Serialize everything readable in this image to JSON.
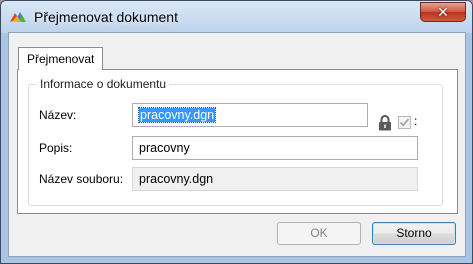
{
  "window": {
    "title": "Přejmenovat dokument",
    "app_icon": "rename-document-icon",
    "close_glyph": "✕",
    "close_icon": "close-icon"
  },
  "tabs": [
    {
      "label": "Přejmenovat",
      "active": true
    }
  ],
  "group": {
    "title": "Informace o dokumentu",
    "fields": {
      "name": {
        "label": "Název:",
        "value": "pracovny.dgn",
        "selected": true
      },
      "description": {
        "label": "Popis:",
        "value": "pracovny"
      },
      "filename": {
        "label": "Název souboru:",
        "value": "pracovny.dgn",
        "readonly": true
      }
    },
    "lock_icon": "lock-icon",
    "checkbox": {
      "checked": true,
      "disabled": true,
      "label": ":"
    }
  },
  "buttons": {
    "ok": {
      "label": "OK",
      "disabled": true
    },
    "cancel": {
      "label": "Storno"
    }
  },
  "colors": {
    "selection": "#3399ff",
    "close_button": "#c7452d",
    "title_gradient_top": "#d9e7f6",
    "title_gradient_bottom": "#bcd3ec"
  }
}
